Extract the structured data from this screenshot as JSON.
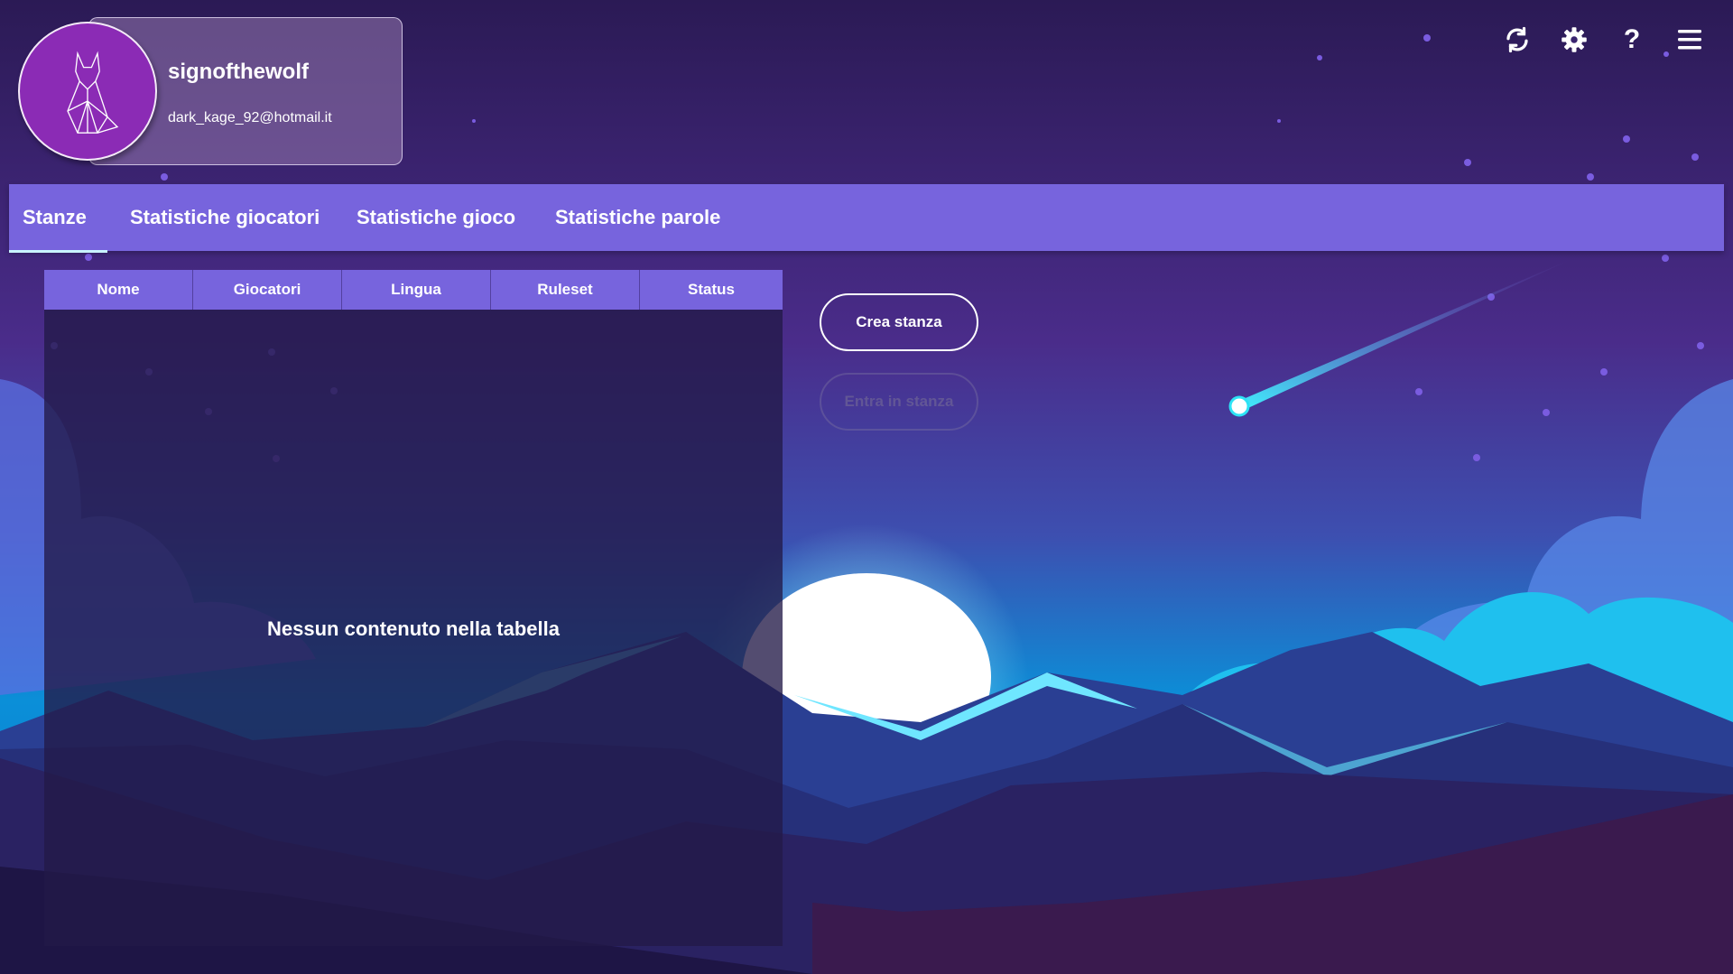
{
  "user": {
    "username": "signofthewolf",
    "email": "dark_kage_92@hotmail.it"
  },
  "toolbar": {
    "icons": [
      "refresh-icon",
      "gear-icon",
      "help-icon",
      "menu-icon"
    ]
  },
  "nav": {
    "tabs": [
      {
        "label": "Stanze",
        "active": true
      },
      {
        "label": "Statistiche giocatori",
        "active": false
      },
      {
        "label": "Statistiche gioco",
        "active": false
      },
      {
        "label": "Statistiche parole",
        "active": false
      }
    ]
  },
  "table": {
    "columns": [
      "Nome",
      "Giocatori",
      "Lingua",
      "Ruleset",
      "Status"
    ],
    "rows": [],
    "empty_message": "Nessun contenuto nella tabella"
  },
  "actions": {
    "create_label": "Crea stanza",
    "join_label": "Entra in stanza",
    "join_enabled": false
  },
  "colors": {
    "accent": "#7764dd",
    "avatar": "#8b2bb5",
    "sky_top": "#2a1a55",
    "horizon": "#0096d6"
  }
}
